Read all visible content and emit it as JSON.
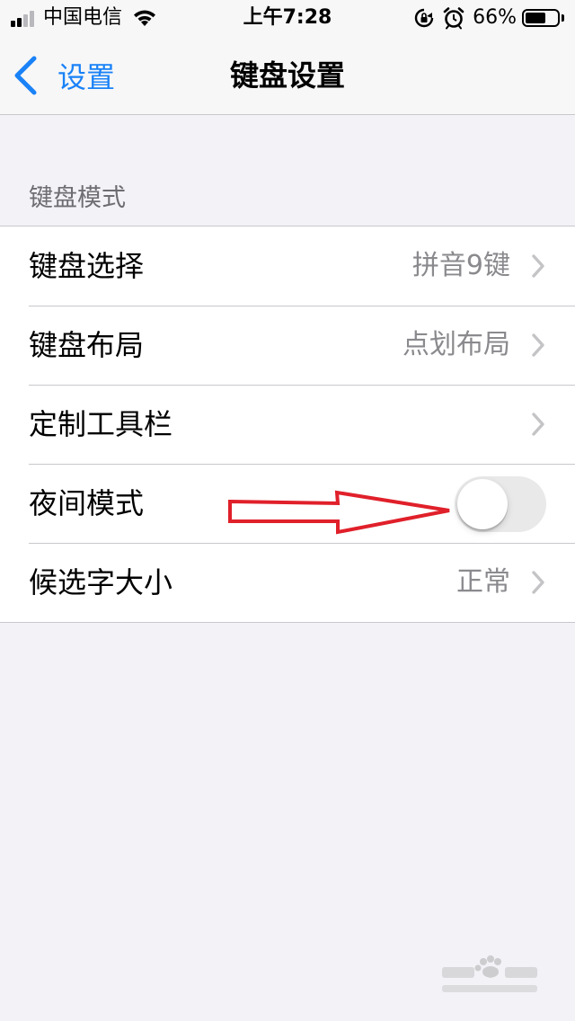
{
  "status_bar": {
    "carrier": "中国电信",
    "time": "上午7:28",
    "battery_percent": "66%",
    "battery_level": 0.66,
    "signal_bars_active": 2,
    "signal_bars_total": 4
  },
  "nav": {
    "back_label": "设置",
    "title": "键盘设置"
  },
  "section": {
    "header": "键盘模式",
    "rows": [
      {
        "label": "键盘选择",
        "value": "拼音9键",
        "type": "disclosure"
      },
      {
        "label": "键盘布局",
        "value": "点划布局",
        "type": "disclosure"
      },
      {
        "label": "定制工具栏",
        "value": "",
        "type": "disclosure"
      },
      {
        "label": "夜间模式",
        "type": "toggle",
        "on": false
      },
      {
        "label": "候选字大小",
        "value": "正常",
        "type": "disclosure"
      }
    ]
  },
  "colors": {
    "accent": "#1a82f7",
    "background": "#f2f2f7",
    "annotation": "#e0202a",
    "toggle_off": "#e9e9ea"
  },
  "icons": {
    "back": "chevron-left-icon",
    "disclosure": "chevron-right-icon",
    "wifi": "wifi-icon",
    "rotation_lock": "rotation-lock-icon",
    "alarm": "alarm-icon",
    "battery": "battery-icon",
    "annotation": "red-arrow-annotation"
  }
}
